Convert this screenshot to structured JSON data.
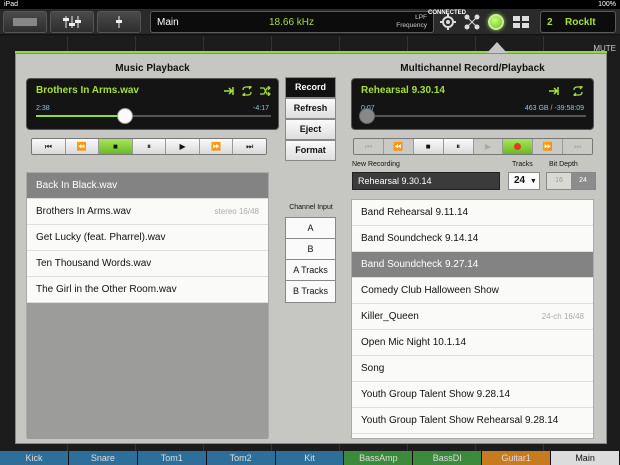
{
  "status": {
    "device": "iPad",
    "time": "",
    "battery": "100%"
  },
  "topbar": {
    "main_label": "Main",
    "frequency": "18.66 kHz",
    "filter_line1": "LPF",
    "filter_line2": "Frequency",
    "connected": "CONNECTED",
    "preset_number": "2",
    "preset_name": "RockIt"
  },
  "mixer": {
    "mute_label": "MUTE"
  },
  "channels": [
    {
      "name": "Kick",
      "color": "#2e6f9a"
    },
    {
      "name": "Snare",
      "color": "#2e6f9a"
    },
    {
      "name": "Tom1",
      "color": "#2e6f9a"
    },
    {
      "name": "Tom2",
      "color": "#2e6f9a"
    },
    {
      "name": "Kit",
      "color": "#2e6f9a"
    },
    {
      "name": "BassAmp",
      "color": "#3c8a3c"
    },
    {
      "name": "BassDI",
      "color": "#3c8a3c"
    },
    {
      "name": "Guitar1",
      "color": "#c77a1e"
    },
    {
      "name": "Main",
      "color": "#dcdcdc"
    }
  ],
  "music": {
    "title": "Music Playback",
    "now_playing": "Brothers In Arms.wav",
    "elapsed": "2:38",
    "remaining": "-4:17",
    "progress": 0.38,
    "transport": [
      "⏮",
      "⏪",
      "■",
      "⏸",
      "▶",
      "⏩",
      "⏭"
    ],
    "active_index": 2,
    "files": [
      {
        "name": "Back In Black.wav",
        "meta": "",
        "selected": true
      },
      {
        "name": "Brothers In Arms.wav",
        "meta": "stereo 16/48",
        "selected": false
      },
      {
        "name": "Get Lucky (feat. Pharrel).wav",
        "meta": "",
        "selected": false
      },
      {
        "name": "Ten Thousand Words.wav",
        "meta": "",
        "selected": false
      },
      {
        "name": "The Girl in the Other Room.wav",
        "meta": "",
        "selected": false
      }
    ]
  },
  "actions": {
    "buttons": [
      {
        "label": "Record",
        "active": true
      },
      {
        "label": "Refresh",
        "active": false
      },
      {
        "label": "Eject",
        "active": false
      },
      {
        "label": "Format",
        "active": false
      }
    ]
  },
  "channel_input": {
    "title": "Channel Input",
    "options": [
      "A",
      "B",
      "A Tracks",
      "B Tracks"
    ]
  },
  "multi": {
    "title": "Multichannel Record/Playback",
    "now_playing": "Rehearsal 9.30.14",
    "elapsed": "0:07",
    "remaining": "463 GB / -39:58:09",
    "progress": 0.0,
    "transport": [
      "⏮",
      "⏪",
      "■",
      "⏸",
      "▶",
      "●",
      "⏩",
      "⏭"
    ],
    "new_recording_label": "New Recording",
    "new_recording_value": "Rehearsal 9.30.14",
    "tracks_label": "Tracks",
    "tracks_value": "24",
    "bitdepth_label": "Bit Depth",
    "bitdepth_options": [
      "16",
      "24"
    ],
    "bitdepth_selected": 1,
    "recordings": [
      {
        "name": "Band Rehearsal 9.11.14",
        "meta": "",
        "selected": false
      },
      {
        "name": "Band Soundcheck 9.14.14",
        "meta": "",
        "selected": false
      },
      {
        "name": "Band Soundcheck 9.27.14",
        "meta": "",
        "selected": true
      },
      {
        "name": "Comedy Club Halloween Show",
        "meta": "",
        "selected": false
      },
      {
        "name": "Killer_Queen",
        "meta": "24-ch 16/48",
        "selected": false
      },
      {
        "name": "Open Mic Night 10.1.14",
        "meta": "",
        "selected": false
      },
      {
        "name": "Song",
        "meta": "",
        "selected": false
      },
      {
        "name": "Youth Group Talent Show 9.28.14",
        "meta": "",
        "selected": false
      },
      {
        "name": "Youth Group Talent Show Rehearsal 9.28.14",
        "meta": "",
        "selected": false
      }
    ]
  },
  "colors": {
    "accent": "#8fdc3c",
    "display_text": "#a8e036",
    "time_text": "#8fc5e8",
    "record": "#e23b1d"
  }
}
